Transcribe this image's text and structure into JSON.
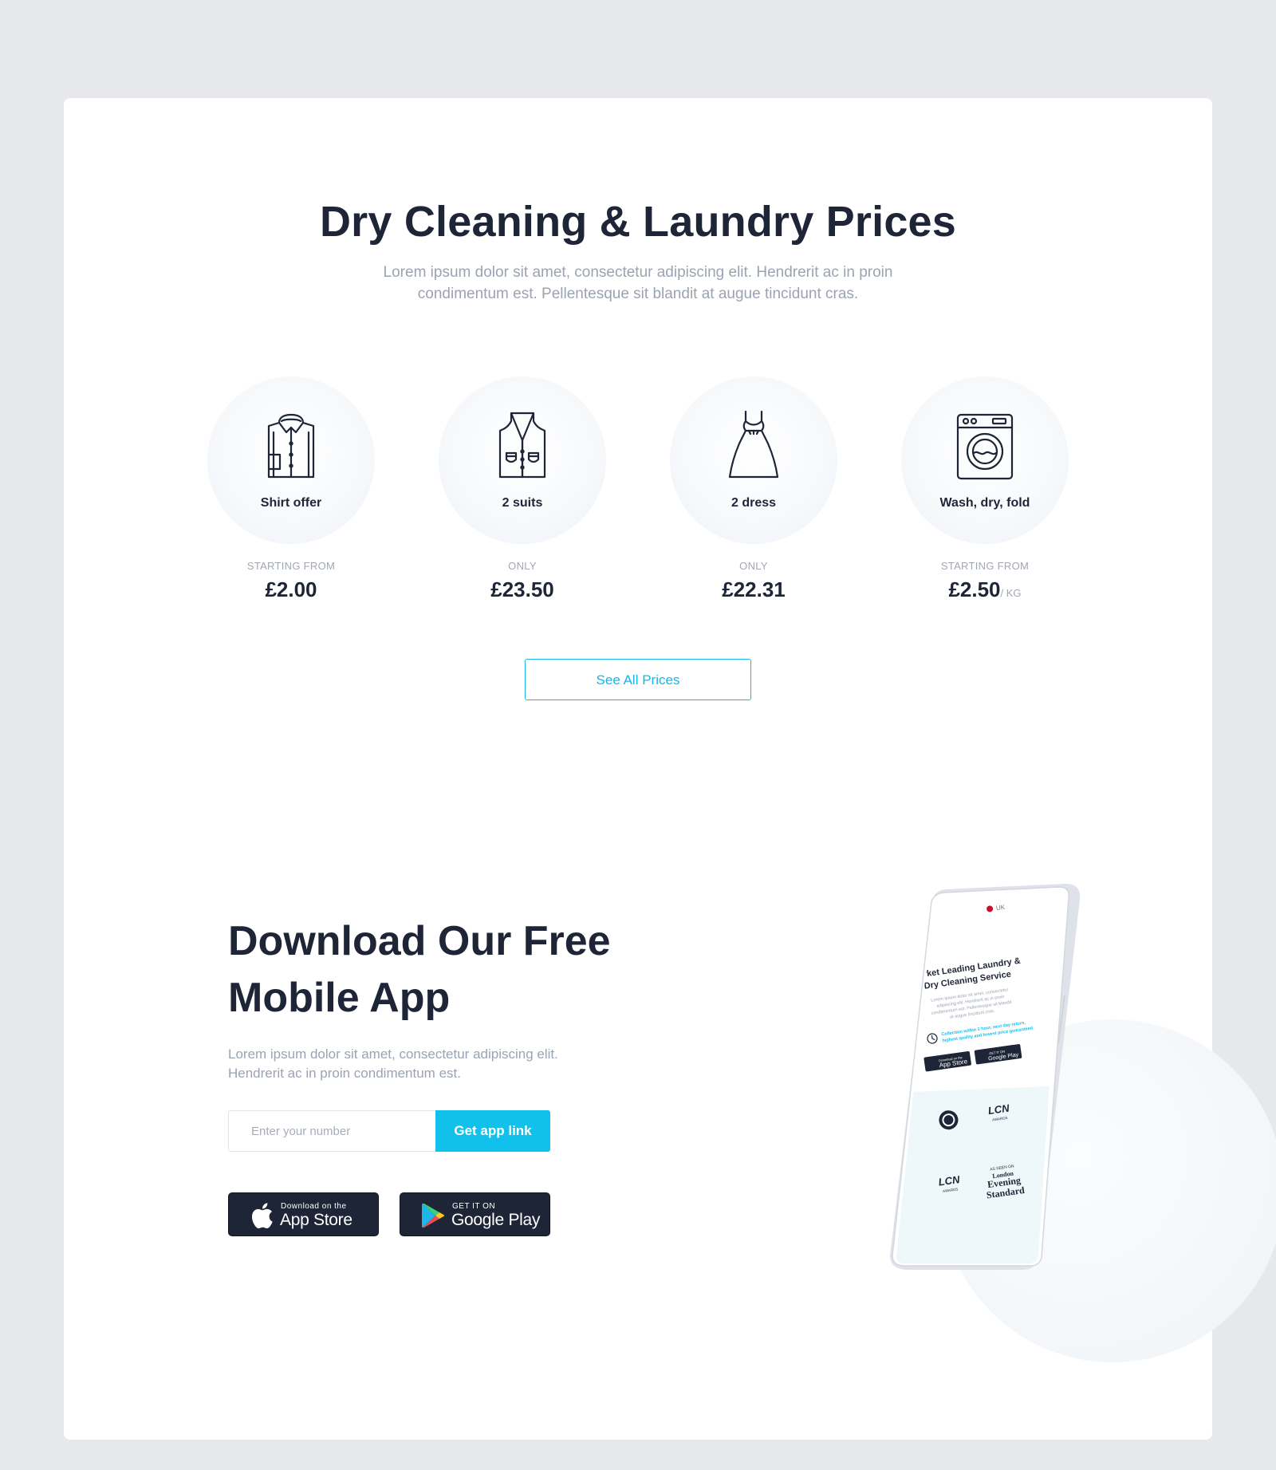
{
  "prices": {
    "title": "Dry Cleaning & Laundry Prices",
    "subtitle": "Lorem ipsum dolor sit amet, consectetur adipiscing elit. Hendrerit ac in proin condimentum est. Pellentesque sit blandit at augue tincidunt cras.",
    "items": [
      {
        "icon": "shirt-icon",
        "label": "Shirt offer",
        "caption": "STARTING FROM",
        "price": "£2.00",
        "unit": ""
      },
      {
        "icon": "vest-icon",
        "label": "2 suits",
        "caption": "ONLY",
        "price": "£23.50",
        "unit": ""
      },
      {
        "icon": "dress-icon",
        "label": "2 dress",
        "caption": "ONLY",
        "price": "£22.31",
        "unit": ""
      },
      {
        "icon": "washing-machine-icon",
        "label": "Wash, dry, fold",
        "caption": "STARTING FROM",
        "price": "£2.50",
        "unit": "/ KG"
      }
    ],
    "see_all_label": "See All Prices"
  },
  "app": {
    "title_line1": "Download Our Free",
    "title_line2": "Mobile App",
    "subtitle": "Lorem ipsum dolor sit amet, consectetur adipiscing elit. Hendrerit ac in proin condimentum est.",
    "input_placeholder": "Enter your number",
    "get_link_label": "Get app link",
    "app_store": {
      "small": "Download on the",
      "big": "App Store"
    },
    "google_play": {
      "small": "GET IT ON",
      "big": "Google Play"
    }
  },
  "phone_mockup": {
    "region": "UK",
    "headline_line1": "Market Leading Laundry &",
    "headline_line2": "Dry Cleaning Service",
    "body": "Lorem ipsum dolor sit amet, consectetur adipiscing elit. Hendrerit ac in proin condimentum est. Pellentesque sit blandit at augue tincidunt cras.",
    "highlight_line1": "Collection within 1 hour, next day return,",
    "highlight_line2": "highest quality and lowest price guaranteed.",
    "app_store_small": "Download on the",
    "app_store_big": "App Store",
    "google_small": "GET IT ON",
    "google_big": "Google Play",
    "award_label": "LCN",
    "award_sub": "AWARDS",
    "press_as_seen": "AS SEEN ON",
    "press_name1": "London",
    "press_name2": "Evening",
    "press_name3": "Standard"
  },
  "colors": {
    "accent": "#12c0ec",
    "heading": "#1e2537",
    "muted": "#9ba3b2",
    "background": "#e6e8ec"
  }
}
